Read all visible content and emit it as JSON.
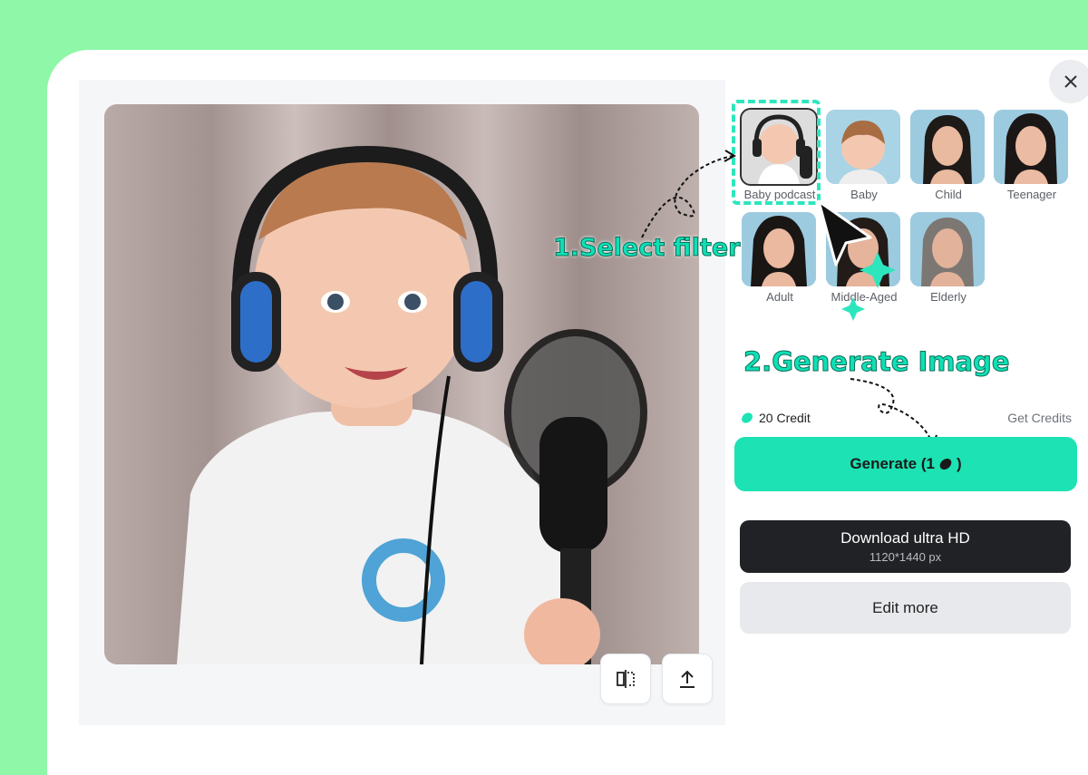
{
  "colors": {
    "page_background": "#8ef7a8",
    "accent": "#1de2b3",
    "annotation": "#0fe0b6",
    "download_bg": "#212226"
  },
  "toolbar": {
    "compare_icon": "split-compare-icon",
    "share_icon": "upload-icon"
  },
  "close_icon": "close-icon",
  "filters": [
    {
      "label": "Baby podcast",
      "selected": true
    },
    {
      "label": "Baby",
      "selected": false
    },
    {
      "label": "Child",
      "selected": false
    },
    {
      "label": "Teenager",
      "selected": false
    },
    {
      "label": "Adult",
      "selected": false
    },
    {
      "label": "Middle-Aged",
      "selected": false
    },
    {
      "label": "Elderly",
      "selected": false
    }
  ],
  "annotations": {
    "step1": "1.Select filter",
    "step2": "2.Generate Image"
  },
  "credits": {
    "balance": "20 Credit",
    "get_label": "Get Credits"
  },
  "generate": {
    "label": "Generate (1",
    "suffix": ")"
  },
  "download": {
    "label": "Download ultra HD",
    "resolution": "1120*1440 px"
  },
  "edit": {
    "label": "Edit more"
  }
}
